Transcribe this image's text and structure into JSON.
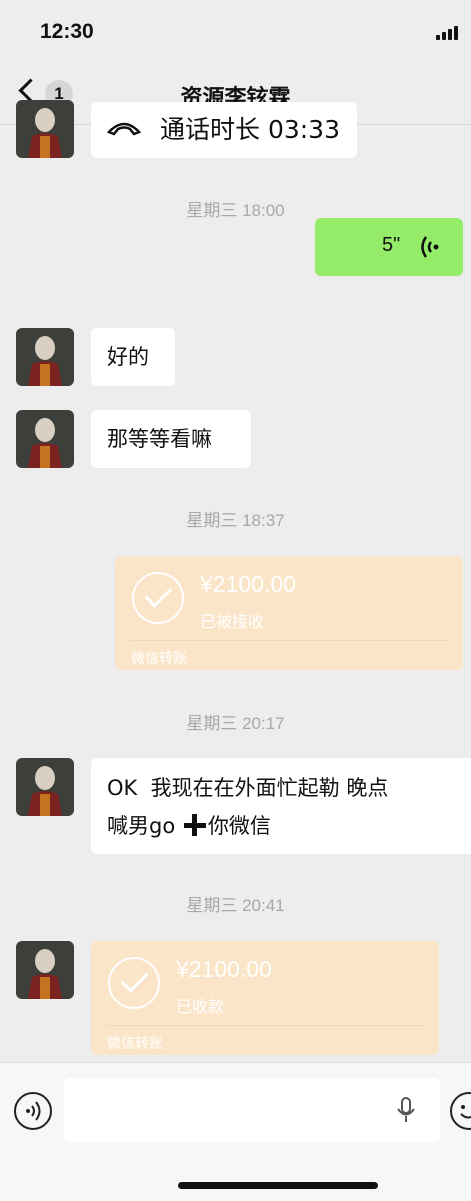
{
  "status_bar": {
    "time": "12:30"
  },
  "header": {
    "back_badge": "1",
    "title": "资源李铉霖"
  },
  "messages": {
    "call_duration": "通话时长 03:33",
    "ts1": "星期三 18:00",
    "voice_duration": "5\"",
    "msg_ok": "好的",
    "msg_wait": "那等等看嘛",
    "ts2": "星期三 18:37",
    "transfer1": {
      "amount": "¥2100.00",
      "status": "已被接收",
      "footer": "微信转账"
    },
    "ts3": "星期三 20:17",
    "msg_long_line1": "OK  我现在在外面忙起勒 晚点",
    "msg_long_line2": "喊男go",
    "msg_long_line3": "你微信",
    "ts4": "星期三 20:41",
    "transfer2": {
      "amount": "¥2100.00",
      "status": "已收款",
      "footer": "微信转账"
    }
  },
  "icons": {
    "back": "chevron-left-icon",
    "voice_wave": "voice-wave-icon",
    "phone": "phone-handset-icon",
    "check": "check-circle-icon",
    "mic": "microphone-icon",
    "voice_input": "voice-input-icon",
    "emoji": "emoji-icon",
    "plus": "plus-icon"
  },
  "colors": {
    "background": "#ededed",
    "outgoing_bubble": "#95ec69",
    "incoming_bubble": "#ffffff",
    "transfer_bubble": "#fbe5c8",
    "timestamp_text": "#a8a8a8"
  }
}
